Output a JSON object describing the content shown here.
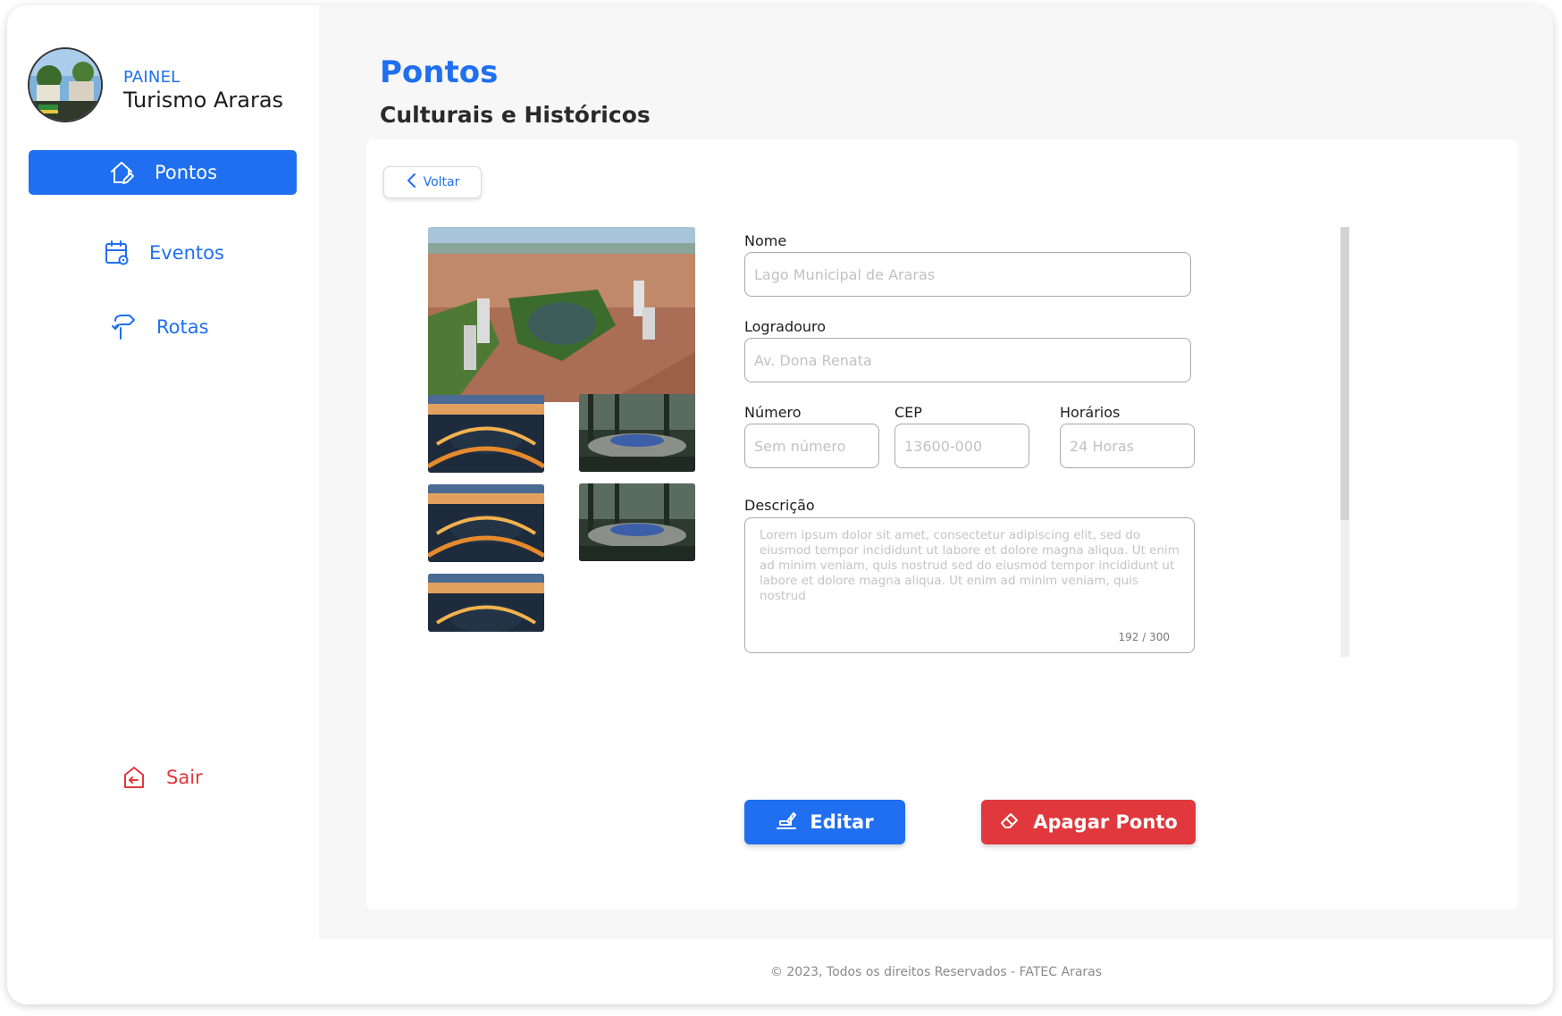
{
  "sidebar": {
    "brand_small": "PAINEL",
    "brand_big": "Turismo Araras",
    "nav": {
      "pontos": "Pontos",
      "eventos": "Eventos",
      "rotas": "Rotas",
      "sair": "Sair"
    }
  },
  "header": {
    "title": "Pontos",
    "subtitle": "Culturais e Históricos"
  },
  "back_label": "Voltar",
  "form": {
    "nome_label": "Nome",
    "nome_placeholder": "Lago Municipal de Araras",
    "logradouro_label": "Logradouro",
    "logradouro_placeholder": "Av. Dona Renata",
    "numero_label": "Número",
    "numero_placeholder": "Sem número",
    "cep_label": "CEP",
    "cep_placeholder": "13600-000",
    "horarios_label": "Horários",
    "horarios_placeholder": "24 Horas",
    "descricao_label": "Descrição",
    "descricao_text": "Lorem ipsum dolor sit amet, consectetur adipiscing elit, sed do eiusmod tempor incididunt ut labore et dolore magna aliqua. Ut enim ad minim veniam, quis nostrud sed do eiusmod tempor incididunt ut labore et dolore magna aliqua. Ut enim ad minim veniam, quis nostrud",
    "descricao_counter": "192 / 300"
  },
  "actions": {
    "edit_label": "Editar",
    "delete_label": "Apagar Ponto"
  },
  "footer": "© 2023, Todos os direitos Reservados - FATEC Araras",
  "colors": {
    "primary": "#1f6ff0",
    "danger": "#e0383c",
    "background": "#f7f7f7"
  }
}
